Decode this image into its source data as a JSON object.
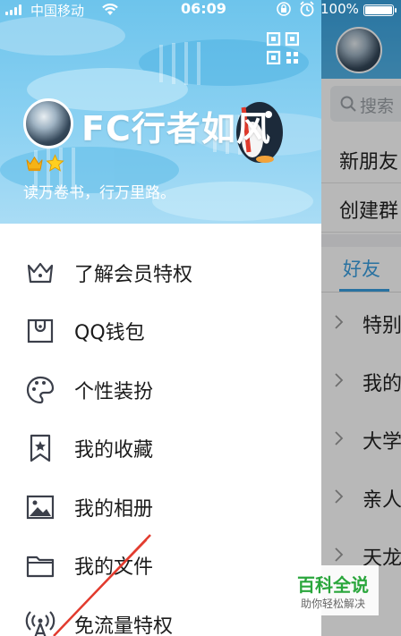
{
  "status_bar": {
    "carrier": "中国移动",
    "time": "06:09",
    "battery": "100%",
    "icons": [
      "signal-icon",
      "wifi-icon",
      "rotation-lock-icon",
      "alarm-icon",
      "battery-icon"
    ]
  },
  "profile": {
    "nickname": "FC行者如风",
    "signature": "读万卷书，行万里路。",
    "badges": [
      "crown-badge-icon",
      "star-badge-icon"
    ]
  },
  "menu": {
    "items": [
      {
        "label": "了解会员特权",
        "icon": "crown-icon"
      },
      {
        "label": "QQ钱包",
        "icon": "wallet-icon"
      },
      {
        "label": "个性装扮",
        "icon": "palette-icon"
      },
      {
        "label": "我的收藏",
        "icon": "bookmark-star-icon"
      },
      {
        "label": "我的相册",
        "icon": "photo-icon"
      },
      {
        "label": "我的文件",
        "icon": "folder-icon"
      },
      {
        "label": "免流量特权",
        "icon": "antenna-icon"
      }
    ]
  },
  "background": {
    "search_placeholder": "搜索",
    "rows": [
      "新朋友",
      "创建群"
    ],
    "tab": "好友",
    "groups": [
      "特别",
      "我的",
      "大学",
      "亲人",
      "天龙"
    ]
  },
  "watermark": {
    "title": "百科全说",
    "subtitle": "助你轻松解决"
  },
  "colors": {
    "header_blue": "#6dc4ec",
    "accent_blue": "#3a9ee0",
    "watermark_green": "#2aa63c"
  }
}
